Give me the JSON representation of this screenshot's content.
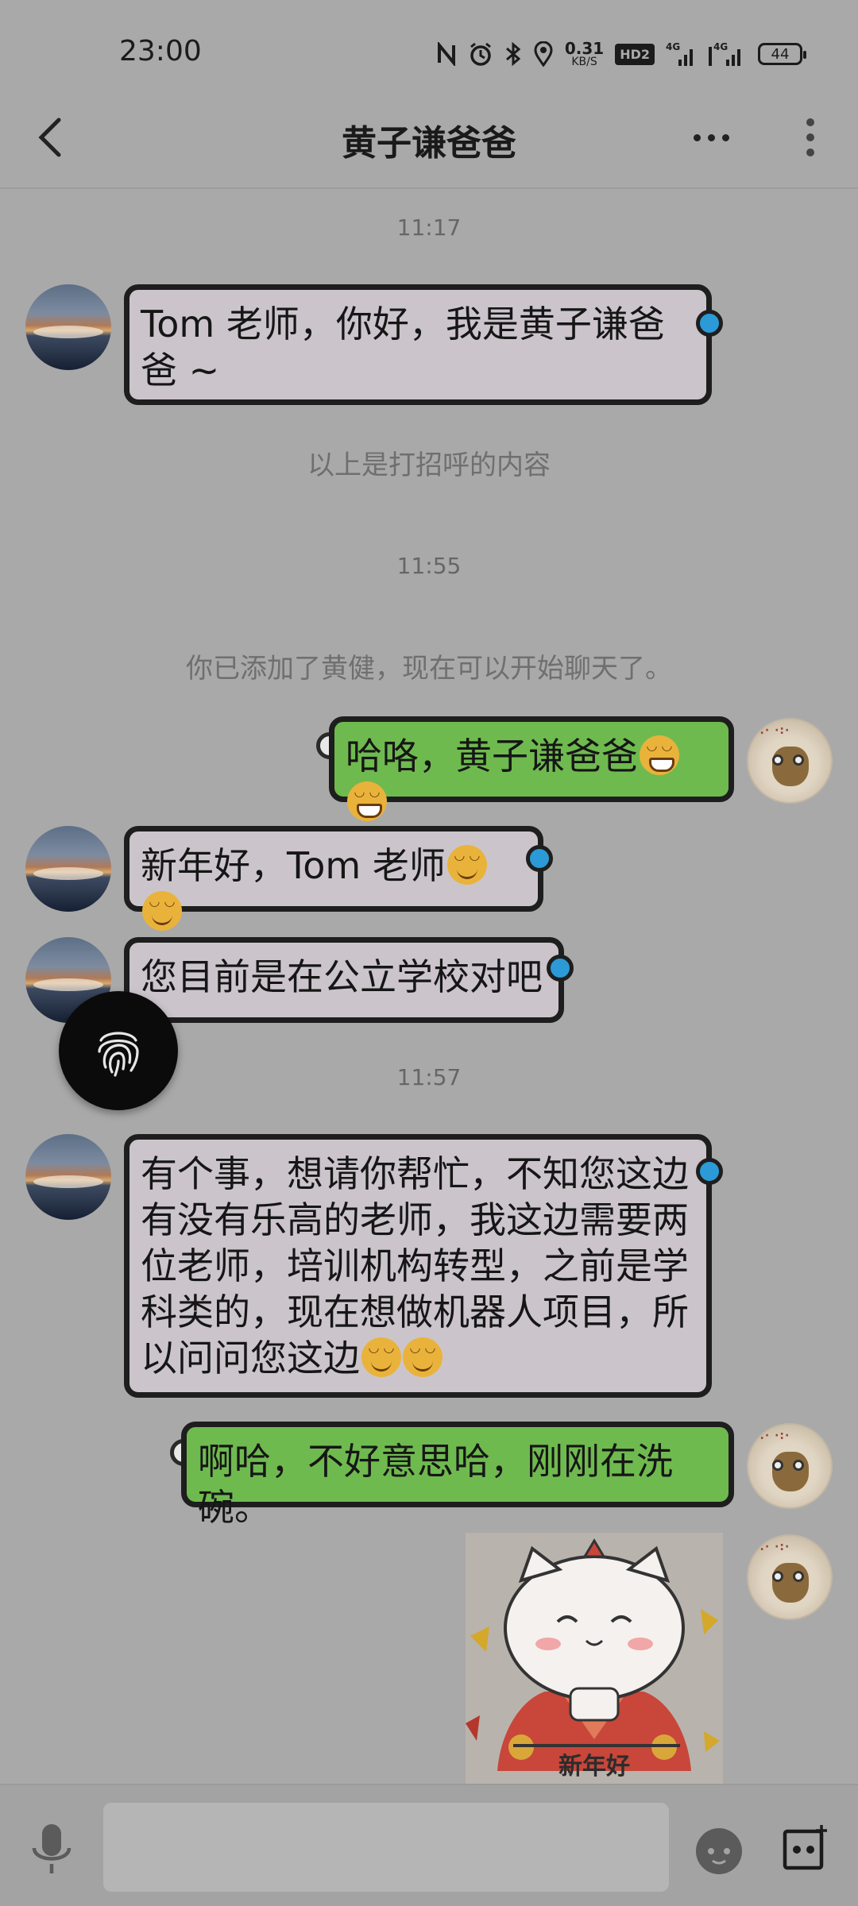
{
  "status_bar": {
    "time": "23:00",
    "net_speed": "0.31",
    "net_speed_unit": "KB/S",
    "hd_badge": "HD2",
    "signal_1": "4G",
    "signal_2": "4G",
    "battery": "44",
    "icons": [
      "nfc-icon",
      "alarm-icon",
      "bluetooth-icon",
      "location-icon",
      "signal-icon",
      "battery-icon"
    ]
  },
  "header": {
    "title": "黄子谦爸爸",
    "icons": [
      "back-icon",
      "more-dots-icon",
      "kebab-menu-icon"
    ]
  },
  "messages": [
    {
      "kind": "timestamp",
      "text": "11:17"
    },
    {
      "kind": "bubble",
      "side": "left",
      "text": "Tom 老师，你好，我是黄子谦爸爸 ~"
    },
    {
      "kind": "system",
      "text": "以上是打招呼的内容"
    },
    {
      "kind": "timestamp",
      "text": "11:55"
    },
    {
      "kind": "system",
      "text": "你已添加了黄健，现在可以开始聊天了。"
    },
    {
      "kind": "bubble",
      "side": "right",
      "text": "哈咯，黄子谦爸爸",
      "emojis": [
        "grin",
        "grin"
      ]
    },
    {
      "kind": "bubble",
      "side": "left",
      "text": "新年好，Tom 老师",
      "emojis": [
        "smile",
        "smile"
      ]
    },
    {
      "kind": "bubble",
      "side": "left",
      "text": "您目前是在公立学校对吧"
    },
    {
      "kind": "timestamp",
      "text": "11:57"
    },
    {
      "kind": "bubble",
      "side": "left",
      "text": "有个事，想请你帮忙，不知您这边有没有乐高的老师，我这边需要两位老师，培训机构转型，之前是学科类的，现在想做机器人项目，所以问问您这边",
      "emojis": [
        "smile",
        "smile"
      ]
    },
    {
      "kind": "bubble",
      "side": "right",
      "text": "啊哈，不好意思哈，刚刚在洗碗。"
    },
    {
      "kind": "sticker",
      "side": "right",
      "text": "新年好"
    }
  ],
  "input_bar": {
    "placeholder": "",
    "icons": [
      "voice-icon",
      "emoji-icon",
      "plus-icon"
    ]
  },
  "floating": {
    "icon": "fingerprint-icon"
  },
  "colors": {
    "background": "#a9a9a9",
    "bubble_in": "#cbc5cb",
    "bubble_out": "#6fba4f",
    "dot_in": "#2b9ad6"
  }
}
